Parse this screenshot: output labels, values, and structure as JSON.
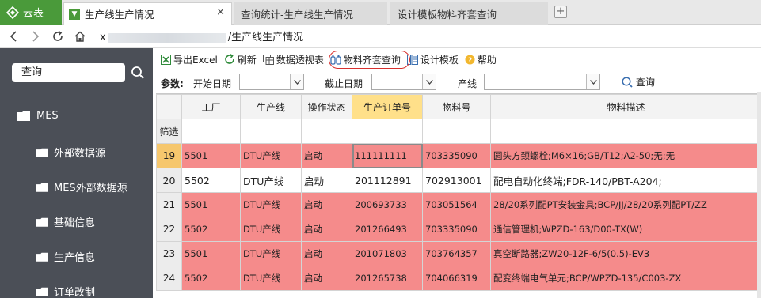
{
  "app": {
    "brand": "云表"
  },
  "tabs": [
    {
      "label": "生产线生产情况",
      "close": "×"
    },
    {
      "label": "查询统计-生产线生产情况"
    },
    {
      "label": "设计模板物料齐套查询"
    }
  ],
  "tab_add": "+",
  "address": {
    "prefix": "x",
    "path": "/生产线生产情况"
  },
  "sidebar": {
    "search_label": "查询",
    "items": [
      {
        "label": "MES"
      },
      {
        "label": "外部数据源"
      },
      {
        "label": "MES外部数据源"
      },
      {
        "label": "基础信息"
      },
      {
        "label": "生产信息"
      },
      {
        "label": "订单改制"
      }
    ]
  },
  "toolbar": {
    "export": "导出Excel",
    "refresh": "刷新",
    "pivot": "数据透视表",
    "kit_query": "物料齐套查询",
    "design": "设计模板",
    "help": "帮助"
  },
  "params": {
    "label": "参数:",
    "start_date": "开始日期",
    "end_date": "截止日期",
    "line": "产线",
    "query": "查询"
  },
  "grid": {
    "columns": [
      "工厂",
      "生产线",
      "操作状态",
      "生产订单号",
      "物料号",
      "物料描述"
    ],
    "filter_label": "筛选",
    "rows": [
      {
        "n": "19",
        "factory": "5501",
        "line": "DTU产线",
        "status": "启动",
        "order": "111111111",
        "material": "703335090",
        "desc": "圆头方颈螺栓;M6×16;GB/T12;A2-50;无;无"
      },
      {
        "n": "20",
        "factory": "5502",
        "line": "DTU产线",
        "status": "启动",
        "order": "201112891",
        "material": "702913001",
        "desc": "配电自动化终端;FDR-140/PBT-A204;"
      },
      {
        "n": "21",
        "factory": "5501",
        "line": "DTU产线",
        "status": "启动",
        "order": "200693733",
        "material": "703051564",
        "desc": "28/20系列配PT安装金具;BCP/JJ/28/20系列配PT/ZZ"
      },
      {
        "n": "22",
        "factory": "5502",
        "line": "DTU产线",
        "status": "启动",
        "order": "201266493",
        "material": "703335090",
        "desc": "通信管理机;WPZD-163/D00-TX(W)"
      },
      {
        "n": "23",
        "factory": "5501",
        "line": "DTU产线",
        "status": "启动",
        "order": "201071803",
        "material": "703764357",
        "desc": "真空断路器;ZW20-12F-6/5(0.5)-EV3"
      },
      {
        "n": "24",
        "factory": "5502",
        "line": "DTU产线",
        "status": "启动",
        "order": "201265738",
        "material": "704066319",
        "desc": "配变终端电气单元;BCP/WPZD-135/C003-ZX"
      }
    ]
  },
  "colors": {
    "brand": "#4a9a3a",
    "sidebar": "#4b4f57",
    "row_highlight": "#f58b8b",
    "selected_header": "#ffe08a",
    "ring": "#d8302e"
  }
}
